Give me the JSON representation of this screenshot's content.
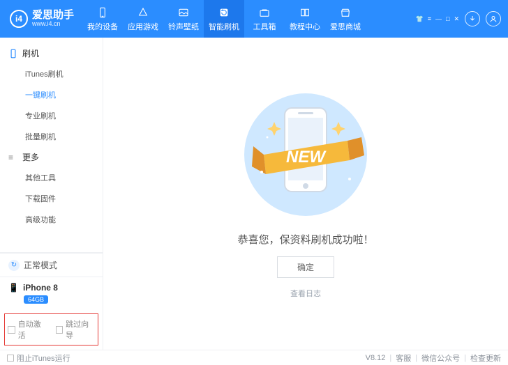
{
  "brand": {
    "name": "爱思助手",
    "url": "www.i4.cn",
    "badge": "i4"
  },
  "nav": [
    {
      "label": "我的设备"
    },
    {
      "label": "应用游戏"
    },
    {
      "label": "铃声壁纸"
    },
    {
      "label": "智能刷机"
    },
    {
      "label": "工具箱"
    },
    {
      "label": "教程中心"
    },
    {
      "label": "爱思商城"
    }
  ],
  "sidebar": {
    "group1": {
      "title": "刷机",
      "items": [
        "iTunes刷机",
        "一键刷机",
        "专业刷机",
        "批量刷机"
      ]
    },
    "group2": {
      "title": "更多",
      "items": [
        "其他工具",
        "下载固件",
        "高级功能"
      ]
    },
    "status": {
      "mode": "正常模式"
    },
    "device": {
      "name": "iPhone 8",
      "storage": "64GB"
    },
    "options": {
      "auto_activate": "自动激活",
      "skip_wizard": "跳过向导"
    }
  },
  "main": {
    "banner": "NEW",
    "message": "恭喜您，保资料刷机成功啦！",
    "ok": "确定",
    "view_log": "查看日志"
  },
  "footer": {
    "block_itunes": "阻止iTunes运行",
    "version": "V8.12",
    "links": [
      "客服",
      "微信公众号",
      "检查更新"
    ]
  }
}
